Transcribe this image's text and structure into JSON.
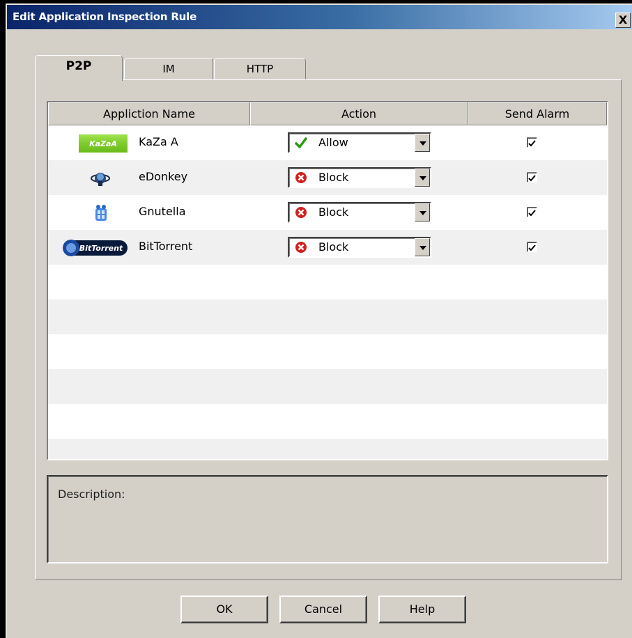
{
  "window": {
    "title": "Edit Application  Inspection Rule",
    "close_label": "X"
  },
  "tabs": [
    {
      "label": "P2P",
      "active": true
    },
    {
      "label": "IM",
      "active": false
    },
    {
      "label": "HTTP",
      "active": false
    }
  ],
  "table": {
    "columns": [
      "Appliction Name",
      "Action",
      "Send Alarm"
    ],
    "rows": [
      {
        "name": "KaZa A",
        "icon": "kazaa-logo-icon",
        "logo_text": "KaZaA",
        "action": "Allow",
        "action_icon": "green-check-icon",
        "send_alarm": true
      },
      {
        "name": "eDonkey",
        "icon": "edonkey-logo-icon",
        "action": "Block",
        "action_icon": "red-x-circle-icon",
        "send_alarm": true
      },
      {
        "name": "Gnutella",
        "icon": "gnutella-logo-icon",
        "action": "Block",
        "action_icon": "red-x-circle-icon",
        "send_alarm": true
      },
      {
        "name": "BitTorrent",
        "icon": "bittorrent-logo-icon",
        "logo_text": "BitTorrent",
        "action": "Block",
        "action_icon": "red-x-circle-icon",
        "send_alarm": true
      }
    ]
  },
  "description": {
    "label": "Description:"
  },
  "buttons": {
    "ok": "OK",
    "cancel": "Cancel",
    "help": "Help"
  },
  "colors": {
    "title_gradient_start": "#0a246a",
    "title_gradient_end": "#a6caf0",
    "dialog_bg": "#d4d0c8",
    "alt_row": "#f0f0f0"
  }
}
